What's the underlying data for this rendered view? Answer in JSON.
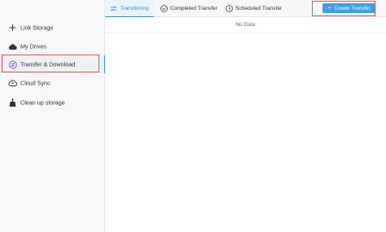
{
  "sidebar": {
    "items": [
      {
        "label": "Link Storage",
        "icon": "plus-icon"
      },
      {
        "label": "My Drives",
        "icon": "cloud-icon"
      },
      {
        "label": "Transfer & Download",
        "icon": "transfer-icon"
      },
      {
        "label": "Cloud Sync",
        "icon": "cloud-sync-icon"
      },
      {
        "label": "Clean up storage",
        "icon": "broom-icon"
      }
    ],
    "active_index": 2
  },
  "tabs": [
    {
      "label": "Transferring",
      "icon": "transfer-arrows-icon",
      "active": true
    },
    {
      "label": "Completed Transfer",
      "icon": "check-circle-icon",
      "active": false
    },
    {
      "label": "Scheduled Transfer",
      "icon": "clock-icon",
      "active": false
    }
  ],
  "create_button": {
    "label": "Create Transfer",
    "icon": "plus-icon"
  },
  "table": {
    "empty_text": "No Data"
  },
  "colors": {
    "accent": "#3a8ee6",
    "button": "#3fa0e8",
    "highlight": "#e0505a"
  }
}
